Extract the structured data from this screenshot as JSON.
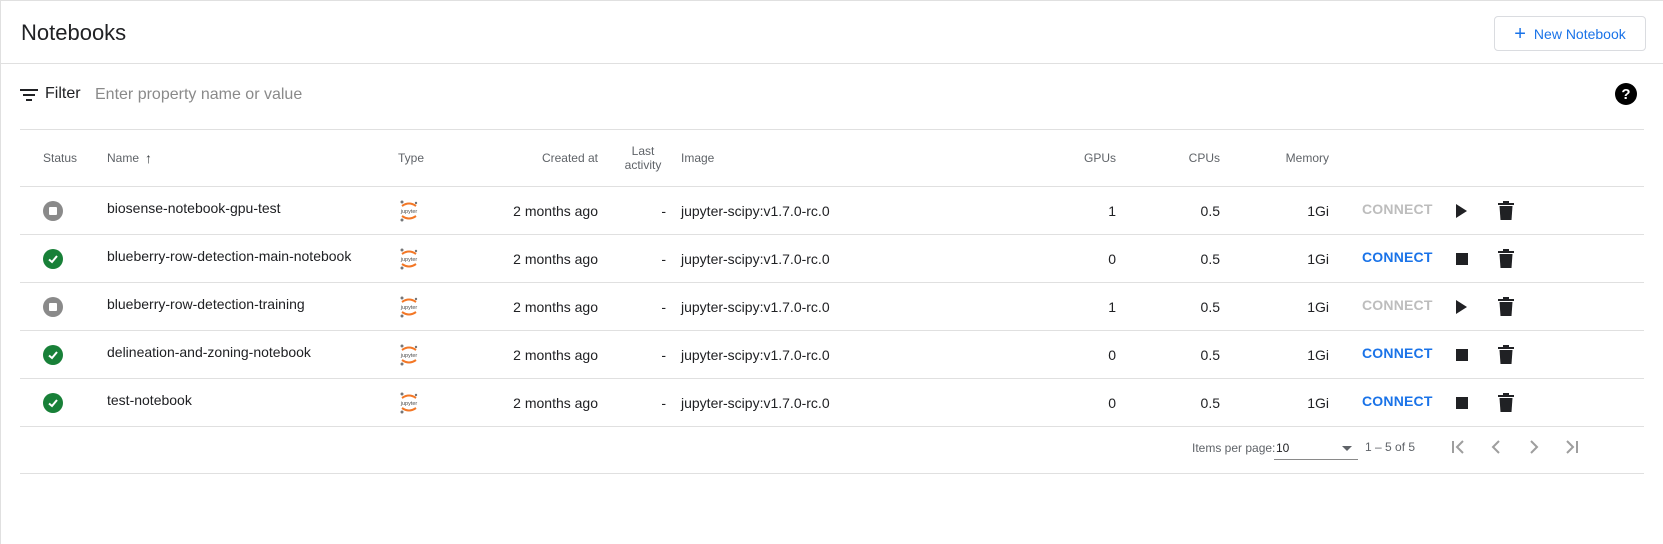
{
  "header": {
    "title": "Notebooks",
    "new_button_label": "New Notebook"
  },
  "filter": {
    "label": "Filter",
    "placeholder": "Enter property name or value"
  },
  "table": {
    "columns": {
      "status": "Status",
      "name": "Name",
      "type": "Type",
      "created": "Created at",
      "last_activity": "Last activity",
      "image": "Image",
      "gpus": "GPUs",
      "cpus": "CPUs",
      "memory": "Memory"
    },
    "rows": [
      {
        "status": "stopped",
        "name": "biosense-notebook-gpu-test",
        "type_icon": "jupyter-icon",
        "created": "2 months ago",
        "last_activity": "-",
        "image": "jupyter-scipy:v1.7.0-rc.0",
        "gpus": "1",
        "cpus": "0.5",
        "memory": "1Gi",
        "connect": "CONNECT",
        "connect_enabled": false,
        "action": "start"
      },
      {
        "status": "running",
        "name": "blueberry-row-detection-main-notebook",
        "type_icon": "jupyter-icon",
        "created": "2 months ago",
        "last_activity": "-",
        "image": "jupyter-scipy:v1.7.0-rc.0",
        "gpus": "0",
        "cpus": "0.5",
        "memory": "1Gi",
        "connect": "CONNECT",
        "connect_enabled": true,
        "action": "stop"
      },
      {
        "status": "stopped",
        "name": "blueberry-row-detection-training",
        "type_icon": "jupyter-icon",
        "created": "2 months ago",
        "last_activity": "-",
        "image": "jupyter-scipy:v1.7.0-rc.0",
        "gpus": "1",
        "cpus": "0.5",
        "memory": "1Gi",
        "connect": "CONNECT",
        "connect_enabled": false,
        "action": "start"
      },
      {
        "status": "running",
        "name": "delineation-and-zoning-notebook",
        "type_icon": "jupyter-icon",
        "created": "2 months ago",
        "last_activity": "-",
        "image": "jupyter-scipy:v1.7.0-rc.0",
        "gpus": "0",
        "cpus": "0.5",
        "memory": "1Gi",
        "connect": "CONNECT",
        "connect_enabled": true,
        "action": "stop"
      },
      {
        "status": "running",
        "name": "test-notebook",
        "type_icon": "jupyter-icon",
        "created": "2 months ago",
        "last_activity": "-",
        "image": "jupyter-scipy:v1.7.0-rc.0",
        "gpus": "0",
        "cpus": "0.5",
        "memory": "1Gi",
        "connect": "CONNECT",
        "connect_enabled": true,
        "action": "stop"
      }
    ]
  },
  "paginator": {
    "items_per_page_label": "Items per page:",
    "items_per_page": "10",
    "range": "1 – 5 of 5"
  },
  "colors": {
    "accent": "#1a73e8",
    "running": "#188038",
    "stopped": "#8a8a8a",
    "disabled_text": "#bdbdbd"
  }
}
